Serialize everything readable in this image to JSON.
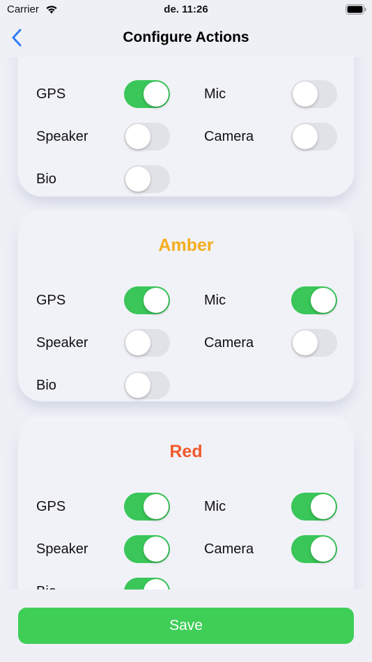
{
  "status_bar": {
    "carrier": "Carrier",
    "time": "de. 11:26"
  },
  "nav": {
    "title": "Configure Actions"
  },
  "colors": {
    "on": "#3ac659",
    "off": "#e1e2e7",
    "amber": "#f4ad1e",
    "red": "#f05a2c",
    "save": "#3fcf57"
  },
  "cards": [
    {
      "title": "",
      "toggles": [
        {
          "label": "GPS",
          "on": true
        },
        {
          "label": "Mic",
          "on": false
        },
        {
          "label": "Speaker",
          "on": false
        },
        {
          "label": "Camera",
          "on": false
        },
        {
          "label": "Bio",
          "on": false
        }
      ]
    },
    {
      "title": "Amber",
      "toggles": [
        {
          "label": "GPS",
          "on": true
        },
        {
          "label": "Mic",
          "on": true
        },
        {
          "label": "Speaker",
          "on": false
        },
        {
          "label": "Camera",
          "on": false
        },
        {
          "label": "Bio",
          "on": false
        }
      ]
    },
    {
      "title": "Red",
      "toggles": [
        {
          "label": "GPS",
          "on": true
        },
        {
          "label": "Mic",
          "on": true
        },
        {
          "label": "Speaker",
          "on": true
        },
        {
          "label": "Camera",
          "on": true
        },
        {
          "label": "Bio",
          "on": true
        }
      ]
    }
  ],
  "save_button": {
    "label": "Save"
  }
}
